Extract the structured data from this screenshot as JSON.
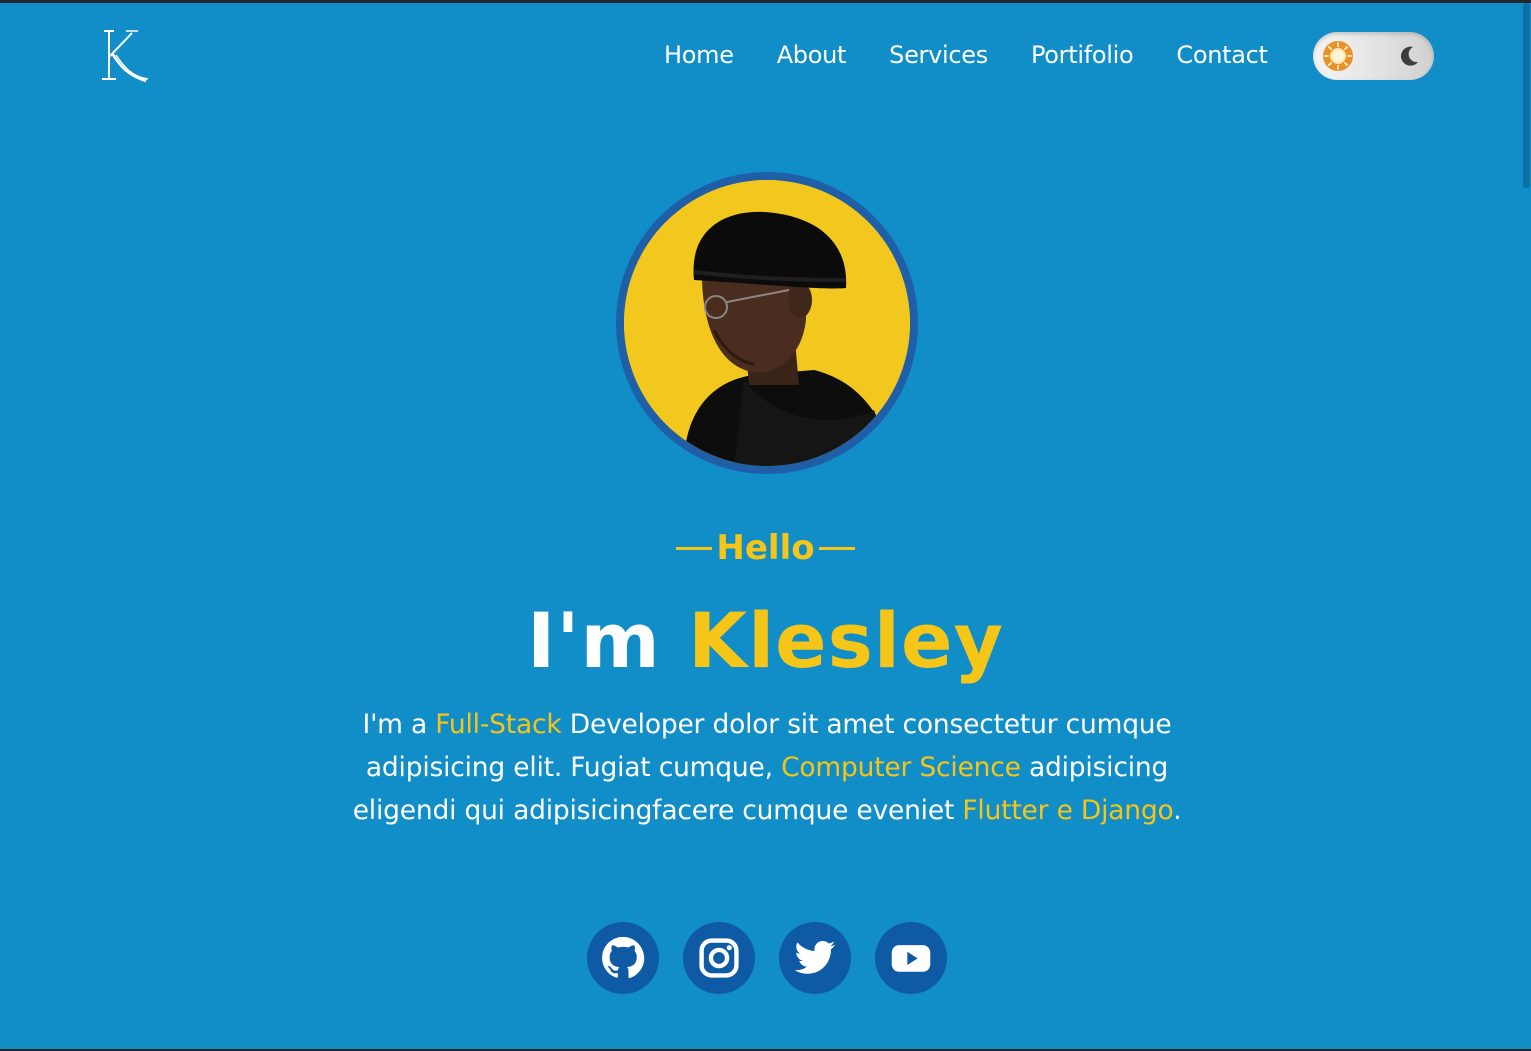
{
  "brand": {
    "logo_letter": "K",
    "logo_icon": "k-monogram-logo"
  },
  "nav": {
    "items": [
      {
        "label": "Home"
      },
      {
        "label": "About"
      },
      {
        "label": "Services"
      },
      {
        "label": "Portifolio"
      },
      {
        "label": "Contact"
      }
    ]
  },
  "theme_toggle": {
    "light_icon": "sun-icon",
    "dark_icon": "moon-icon",
    "state": "light"
  },
  "hero": {
    "greeting": "Hello",
    "headline_prefix": "I'm",
    "name": "Klesley",
    "bio": {
      "t1": "I'm a ",
      "h1": "Full-Stack",
      "t2": " Developer dolor sit amet consectetur cumque adipisicing elit. Fugiat cumque, ",
      "h2": "Computer Science",
      "t3": " adipisicing eligendi qui adipisicingfacere cumque eveniet ",
      "h3": "Flutter e Django",
      "t4": "."
    }
  },
  "socials": [
    {
      "icon": "github-icon"
    },
    {
      "icon": "instagram-icon"
    },
    {
      "icon": "twitter-icon"
    },
    {
      "icon": "youtube-icon"
    }
  ],
  "colors": {
    "background": "#118ec8",
    "accent": "#f5c518",
    "social_bg": "#0e5aa5",
    "avatar_ring": "#1e5fa8"
  }
}
